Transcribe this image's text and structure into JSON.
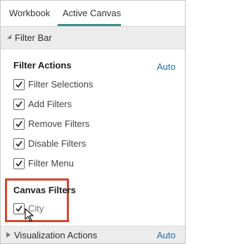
{
  "tabs": [
    {
      "label": "Workbook"
    },
    {
      "label": "Active Canvas"
    }
  ],
  "active_tab": "Active Canvas",
  "filter_bar": {
    "title": "Filter Bar",
    "expanded": true
  },
  "filter_actions": {
    "heading": "Filter Actions",
    "auto_label": "Auto",
    "items": [
      {
        "label": "Filter Selections",
        "checked": true
      },
      {
        "label": "Add Filters",
        "checked": true
      },
      {
        "label": "Remove Filters",
        "checked": true
      },
      {
        "label": "Disable Filters",
        "checked": true
      },
      {
        "label": "Filter Menu",
        "checked": true
      }
    ]
  },
  "canvas_filters": {
    "heading": "Canvas Filters",
    "items": [
      {
        "label": "City",
        "checked": true
      }
    ]
  },
  "visualization_actions": {
    "title": "Visualization Actions",
    "auto_label": "Auto",
    "expanded": false
  },
  "colors": {
    "accent": "#3a8f8f",
    "link": "#1d6fa8",
    "highlight": "#d5462c"
  }
}
